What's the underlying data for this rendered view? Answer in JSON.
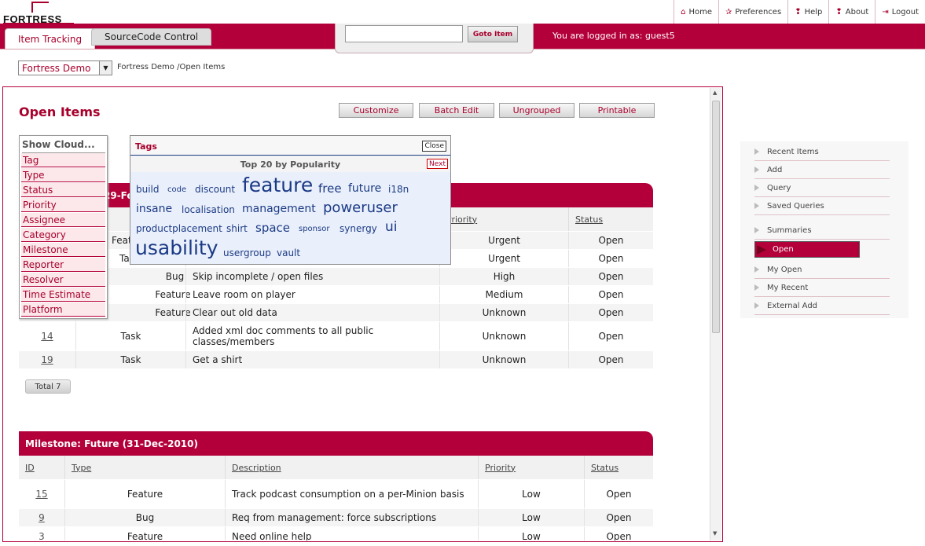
{
  "header": {
    "logo_text": "FORTRESS",
    "links": [
      {
        "icon": "home-icon",
        "glyph": "⌂",
        "label": "Home"
      },
      {
        "icon": "star-icon",
        "glyph": "✰",
        "label": "Preferences"
      },
      {
        "icon": "help-icon",
        "glyph": "❢",
        "label": "Help"
      },
      {
        "icon": "about-icon",
        "glyph": "❢",
        "label": "About"
      },
      {
        "icon": "logout-icon",
        "glyph": "⇥",
        "label": "Logout"
      }
    ],
    "tabs": [
      {
        "label": "Item Tracking"
      },
      {
        "label": "SourceCode Control"
      }
    ],
    "goto": {
      "placeholder": "",
      "button": "Goto Item"
    },
    "logged_in": "You are logged in as: guest5"
  },
  "project": {
    "selected": "Fortress Demo",
    "breadcrumb": "Fortress Demo",
    "breadcrumb_tail": " /Open Items"
  },
  "page": {
    "title": "Open Items",
    "buttons": [
      "Customize",
      "Batch Edit",
      "Ungrouped",
      "Printable"
    ],
    "total": "Total 7"
  },
  "cloud_list": {
    "header": "Show Cloud...",
    "items": [
      "Tag",
      "Type",
      "Status",
      "Priority",
      "Assignee",
      "Category",
      "Milestone",
      "Reporter",
      "Resolver",
      "Time Estimate",
      "Platform"
    ]
  },
  "tags": {
    "title": "Tags",
    "close": "Close",
    "subtitle": "Top 20 by Popularity",
    "next": "Next",
    "words": [
      "build",
      "code",
      "discount",
      "feature",
      "free",
      "future",
      "i18n",
      "insane",
      "localisation",
      "management",
      "poweruser",
      "productplacement",
      "shirt",
      "space",
      "sponsor",
      "synergy",
      "ui",
      "usability",
      "usergroup",
      "vault"
    ]
  },
  "milestone1": {
    "title": "Milestone: ...29-Feb...",
    "title_visible": "29-Fe",
    "headers": {
      "priority": "Priority",
      "status": "Status"
    },
    "rows": [
      {
        "id": "",
        "type": "Feature",
        "description": "",
        "priority": "Urgent",
        "status": "Open"
      },
      {
        "id": "",
        "type": "Task",
        "description": "",
        "priority": "Urgent",
        "status": "Open"
      },
      {
        "id": "",
        "type": "Bug",
        "description": "Skip incomplete / open files",
        "priority": "High",
        "status": "Open"
      },
      {
        "id": "",
        "type": "Feature",
        "description": "Leave room on player",
        "priority": "Medium",
        "status": "Open"
      },
      {
        "id": "",
        "type": "Feature",
        "description": "Clear out old data",
        "priority": "Unknown",
        "status": "Open"
      },
      {
        "id": "14",
        "type": "Task",
        "description": "Added xml doc comments to all public classes/members",
        "priority": "Unknown",
        "status": "Open"
      },
      {
        "id": "19",
        "type": "Task",
        "description": "Get a shirt",
        "priority": "Unknown",
        "status": "Open"
      }
    ]
  },
  "milestone2": {
    "title": "Milestone: Future (31-Dec-2010)",
    "headers": {
      "id": "ID",
      "type": "Type",
      "description": "Description",
      "priority": "Priority",
      "status": "Status"
    },
    "rows": [
      {
        "id": "15",
        "type": "Feature",
        "description": "Track podcast consumption on a per-Minion basis",
        "priority": "Low",
        "status": "Open"
      },
      {
        "id": "9",
        "type": "Bug",
        "description": "Req from management: force subscriptions",
        "priority": "Low",
        "status": "Open"
      },
      {
        "id": "3",
        "type": "Feature",
        "description": "Need online help",
        "priority": "Low",
        "status": "Open"
      }
    ]
  },
  "right_nav": {
    "items": [
      "Recent Items",
      "Add",
      "Query",
      "Saved Queries",
      "Summaries",
      "Open",
      "My Open",
      "My Recent",
      "External Add"
    ],
    "active": "Open"
  },
  "colors": {
    "brand": "#b4003a",
    "tag_blue": "#1b3a85"
  }
}
